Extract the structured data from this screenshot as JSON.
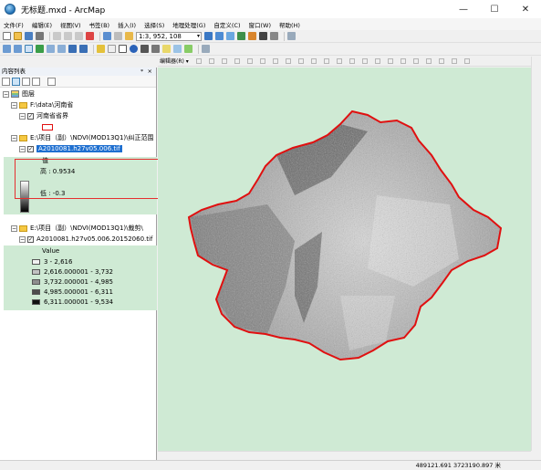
{
  "window": {
    "title": "无标题.mxd - ArcMap",
    "minimize": "—",
    "maximize": "☐",
    "close": "✕"
  },
  "menu": [
    "文件(F)",
    "编辑(E)",
    "视图(V)",
    "书签(B)",
    "插入(I)",
    "选择(S)",
    "地理处理(G)",
    "自定义(C)",
    "窗口(W)",
    "帮助(H)"
  ],
  "toolbar": {
    "scale": "1:3, 952, 108",
    "editor_label": "编辑器(R) ▾"
  },
  "toc": {
    "title": "内容列表",
    "root": "图层",
    "groups": [
      {
        "path": "F:\\data\\河南省",
        "layer": "河南省省界"
      },
      {
        "path": "E:\\项目（副）\\NDVI(MOD13Q1)\\纠正范围",
        "layer": "A2010081.h27v05.006.tif",
        "legend_title": "值",
        "high": "高 : 0.9534",
        "low": "低 : -0.3"
      },
      {
        "path": "E:\\项目（副）\\NDVI(MOD13Q1)\\裁剪\\",
        "layer": "A2010081.h27v05.006.20152060.tif",
        "legend_title": "Value",
        "classes": [
          "3 - 2,616",
          "2,616.000001 - 3,732",
          "3,732.000001 - 4,985",
          "4,985.000001 - 6,311",
          "6,311.000001 - 9,534"
        ]
      }
    ]
  },
  "status": {
    "coords": "489121.691  3723190.897 米"
  },
  "colors": {
    "map_bg": "#cfead4",
    "boundary": "#e01010",
    "annotation_box": "#e53030",
    "class_swatches": [
      "#f2f2f2",
      "#c2c2c2",
      "#8f8f8f",
      "#4d4d4d",
      "#111111"
    ]
  }
}
